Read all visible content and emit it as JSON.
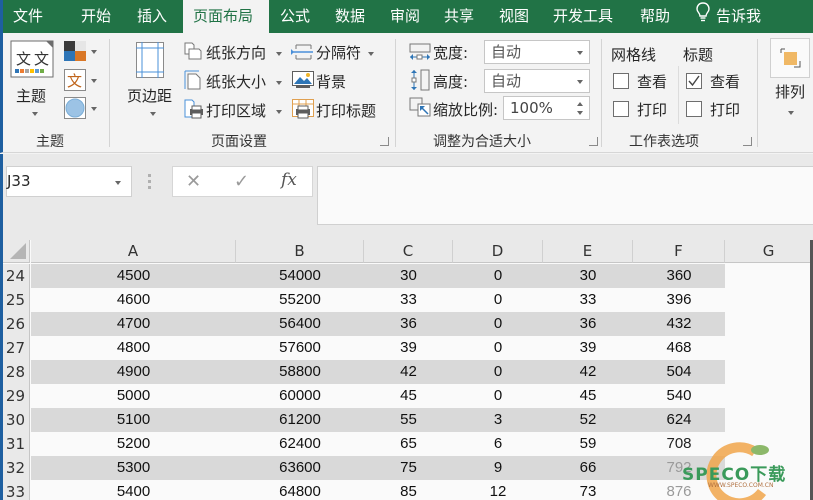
{
  "tabs": [
    {
      "label": "文件"
    },
    {
      "label": "开始"
    },
    {
      "label": "插入"
    },
    {
      "label": "页面布局",
      "active": true
    },
    {
      "label": "公式"
    },
    {
      "label": "数据"
    },
    {
      "label": "审阅"
    },
    {
      "label": "共享"
    },
    {
      "label": "视图"
    },
    {
      "label": "开发工具"
    },
    {
      "label": "帮助"
    },
    {
      "label": "告诉我",
      "icon": "lightbulb-icon"
    }
  ],
  "ribbon": {
    "themes": {
      "group_label": "主题",
      "theme_button": "主题",
      "colors_icon": "theme-colors-icon",
      "fonts_icon": "theme-fonts-icon",
      "effects_icon": "theme-effects-icon"
    },
    "page_setup": {
      "group_label": "页面设置",
      "margins": "页边距",
      "orientation": "纸张方向",
      "size": "纸张大小",
      "print_area": "打印区域",
      "breaks": "分隔符",
      "background": "背景",
      "print_titles": "打印标题"
    },
    "scale_to_fit": {
      "group_label": "调整为合适大小",
      "width_label": "宽度:",
      "width_value": "自动",
      "height_label": "高度:",
      "height_value": "自动",
      "scale_label": "缩放比例:",
      "scale_value": "100%"
    },
    "sheet_options": {
      "group_label": "工作表选项",
      "gridlines_header": "网格线",
      "headings_header": "标题",
      "gridlines_view": {
        "label": "查看",
        "checked": false
      },
      "gridlines_print": {
        "label": "打印",
        "checked": false
      },
      "headings_view": {
        "label": "查看",
        "checked": true
      },
      "headings_print": {
        "label": "打印",
        "checked": false
      }
    },
    "arrange": {
      "label": "排列"
    }
  },
  "formula_bar": {
    "name_box": "J33",
    "cancel_symbol": "✕",
    "enter_symbol": "✓",
    "fx_symbol": "fx",
    "formula": ""
  },
  "sheet": {
    "columns": [
      "A",
      "B",
      "C",
      "D",
      "E",
      "F",
      "G"
    ],
    "rows": [
      {
        "num": "24",
        "cells": [
          "4500",
          "54000",
          "30",
          "0",
          "30",
          "360"
        ],
        "shaded": true
      },
      {
        "num": "25",
        "cells": [
          "4600",
          "55200",
          "33",
          "0",
          "33",
          "396"
        ],
        "shaded": false
      },
      {
        "num": "26",
        "cells": [
          "4700",
          "56400",
          "36",
          "0",
          "36",
          "432"
        ],
        "shaded": true
      },
      {
        "num": "27",
        "cells": [
          "4800",
          "57600",
          "39",
          "0",
          "39",
          "468"
        ],
        "shaded": false
      },
      {
        "num": "28",
        "cells": [
          "4900",
          "58800",
          "42",
          "0",
          "42",
          "504"
        ],
        "shaded": true
      },
      {
        "num": "29",
        "cells": [
          "5000",
          "60000",
          "45",
          "0",
          "45",
          "540"
        ],
        "shaded": false
      },
      {
        "num": "30",
        "cells": [
          "5100",
          "61200",
          "55",
          "3",
          "52",
          "624"
        ],
        "shaded": true
      },
      {
        "num": "31",
        "cells": [
          "5200",
          "62400",
          "65",
          "6",
          "59",
          "708"
        ],
        "shaded": false
      },
      {
        "num": "32",
        "cells": [
          "5300",
          "63600",
          "75",
          "9",
          "66",
          "792"
        ],
        "shaded": true
      },
      {
        "num": "33",
        "cells": [
          "5400",
          "64800",
          "85",
          "12",
          "73",
          "876"
        ],
        "shaded": false
      }
    ]
  },
  "watermark": {
    "text": "SPECO下载",
    "url_text": "WWW.SPECO.COM.CN"
  },
  "colors": {
    "excel_green": "#217346",
    "band_gray": "#d9d9d9",
    "accent_blue": "#1e5fa0"
  }
}
